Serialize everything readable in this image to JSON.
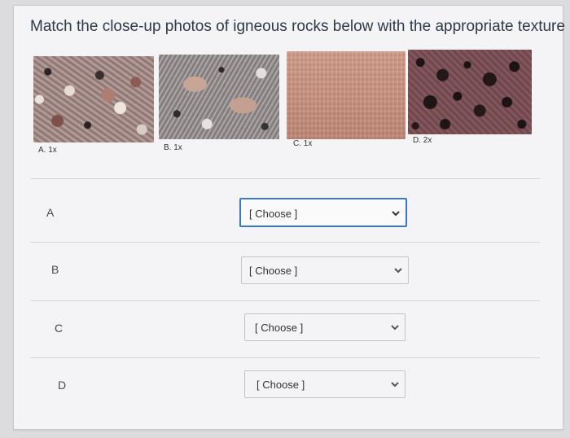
{
  "question": {
    "text": "Match the close-up photos of igneous rocks below with the appropriate texture"
  },
  "photos": [
    {
      "caption": "A. 1x"
    },
    {
      "caption": "B. 1x"
    },
    {
      "caption": "C. 1x"
    },
    {
      "caption": "D. 2x"
    }
  ],
  "rows": [
    {
      "label": "A",
      "select_value": "[ Choose ]"
    },
    {
      "label": "B",
      "select_value": "[ Choose ]"
    },
    {
      "label": "C",
      "select_value": "[ Choose ]"
    },
    {
      "label": "D",
      "select_value": "[ Choose ]"
    }
  ],
  "colors": {
    "focus_border": "#3d77c4",
    "text": "#2d3b45"
  },
  "icons": {
    "select_arrow": "chevron-down-icon"
  }
}
